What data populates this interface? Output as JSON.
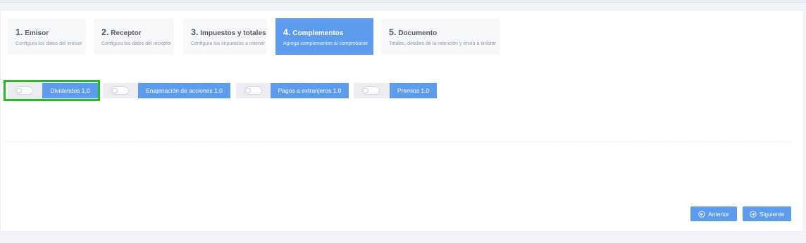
{
  "wizard": {
    "steps": [
      {
        "num": "1.",
        "label": "Emisor",
        "desc": "Configura los datos del emisor"
      },
      {
        "num": "2.",
        "label": "Receptor",
        "desc": "Configura los datos del receptor"
      },
      {
        "num": "3.",
        "label": "Impuestos y totales",
        "desc": "Configura los impuestos a retener"
      },
      {
        "num": "4.",
        "label": "Complementos",
        "desc": "Agrega complementos al comprobante"
      },
      {
        "num": "5.",
        "label": "Documento",
        "desc": "Totales, detalles de la retención y envío a timbrar"
      }
    ],
    "active_step": 4
  },
  "complements": [
    {
      "label": "Dividendos 1.0",
      "enabled": false
    },
    {
      "label": "Enajenación de acciones 1.0",
      "enabled": false
    },
    {
      "label": "Pagos a extranjeros 1.0",
      "enabled": false
    },
    {
      "label": "Premios 1.0",
      "enabled": false
    }
  ],
  "actions": {
    "previous_label": "Anterior",
    "next_label": "Siguiente"
  },
  "colors": {
    "accent": "#5d9cec",
    "highlight": "#22bb22"
  },
  "icons": {
    "previous": "arrow-left-circle-icon",
    "next": "arrow-right-circle-icon"
  }
}
